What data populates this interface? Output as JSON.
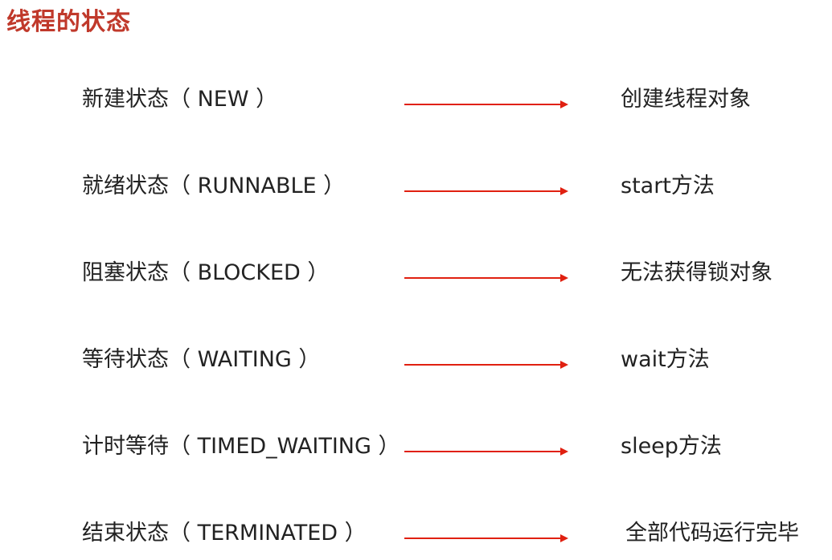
{
  "title": "线程的状态",
  "accent_color": "#e02010",
  "title_color": "#c0392b",
  "rows": [
    {
      "state": "新建状态（ NEW ）",
      "description": "创建线程对象"
    },
    {
      "state": "就绪状态（ RUNNABLE ）",
      "description": "start方法"
    },
    {
      "state": "阻塞状态（ BLOCKED ）",
      "description": "无法获得锁对象"
    },
    {
      "state": "等待状态（ WAITING ）",
      "description": "wait方法"
    },
    {
      "state": "计时等待（ TIMED_WAITING ）",
      "description": "sleep方法"
    },
    {
      "state": "结束状态（ TERMINATED ）",
      "description": "全部代码运行完毕"
    }
  ]
}
